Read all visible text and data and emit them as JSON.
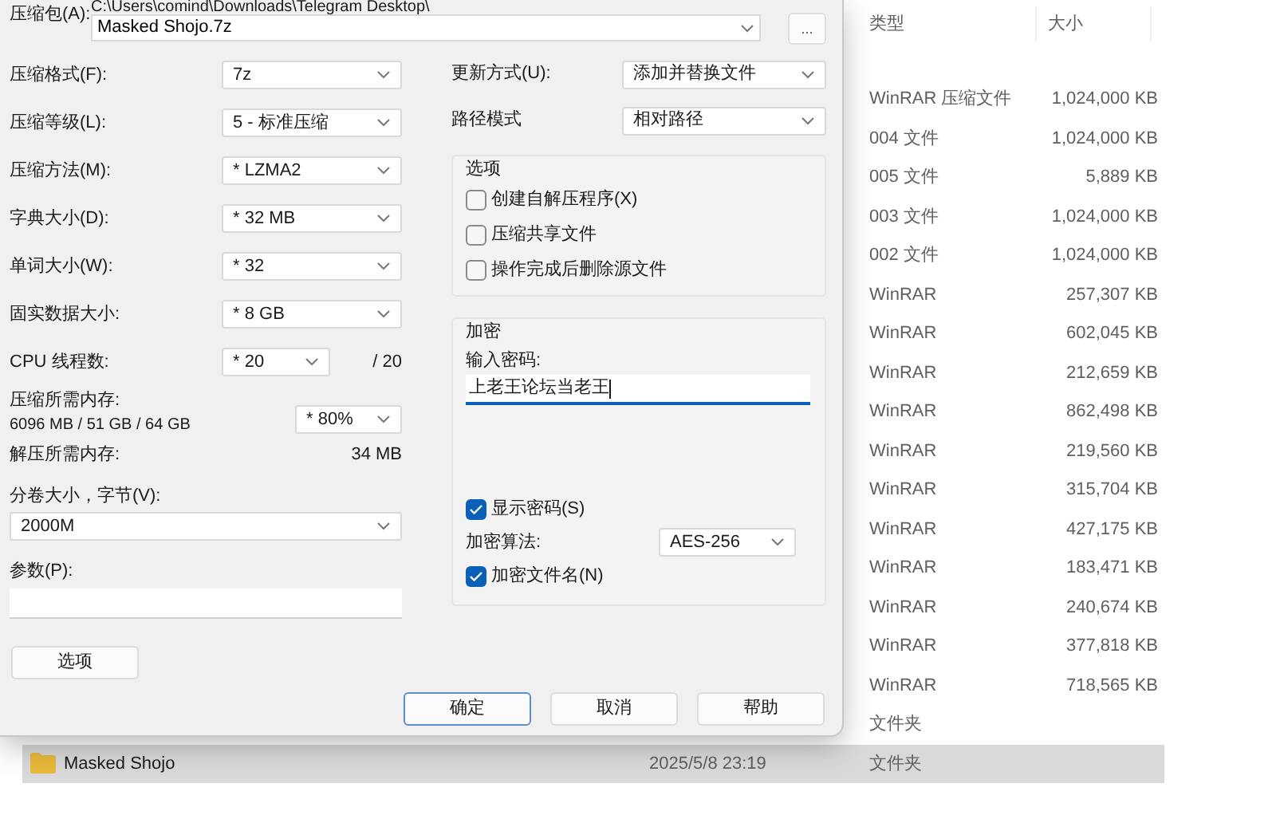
{
  "explorer": {
    "columns": [
      "类型",
      "大小"
    ],
    "rows": [
      {
        "type": "WinRAR 压缩文件",
        "size": "1,024,000 KB",
        "selected": false
      },
      {
        "type": "004 文件",
        "size": "1,024,000 KB",
        "selected": false
      },
      {
        "type": "005 文件",
        "size": "5,889 KB",
        "selected": false
      },
      {
        "type": "003 文件",
        "size": "1,024,000 KB",
        "selected": false
      },
      {
        "type": "002 文件",
        "size": "1,024,000 KB",
        "selected": false
      },
      {
        "type": "WinRAR",
        "size": "257,307 KB",
        "selected": false
      },
      {
        "type": "WinRAR",
        "size": "602,045 KB",
        "selected": false
      },
      {
        "type": "WinRAR",
        "size": "212,659 KB",
        "selected": false
      },
      {
        "type": "WinRAR",
        "size": "862,498 KB",
        "selected": false
      },
      {
        "type": "WinRAR",
        "size": "219,560 KB",
        "selected": false
      },
      {
        "type": "WinRAR",
        "size": "315,704 KB",
        "selected": false
      },
      {
        "type": "WinRAR",
        "size": "427,175 KB",
        "selected": false
      },
      {
        "type": "WinRAR",
        "size": "183,471 KB",
        "selected": false
      },
      {
        "type": "WinRAR",
        "size": "240,674 KB",
        "selected": false
      },
      {
        "type": "WinRAR",
        "size": "377,818 KB",
        "selected": false
      },
      {
        "type": "WinRAR",
        "size": "718,565 KB",
        "selected": false
      },
      {
        "type": "文件夹",
        "selected": false
      },
      {
        "kind": "folder",
        "name": "Masked Shojo",
        "date": "2025/5/8 23:19",
        "type": "文件夹",
        "selected": true
      }
    ]
  },
  "dialog": {
    "archive": {
      "label": "压缩包(A):",
      "path": "C:\\Users\\comind\\Downloads\\Telegram Desktop\\",
      "value": "Masked Shojo.7z",
      "browse": "..."
    },
    "settings": [
      {
        "label": "压缩格式(F):",
        "value": "7z"
      },
      {
        "label": "压缩等级(L):",
        "value": "5 - 标准压缩"
      },
      {
        "label": "压缩方法(M):",
        "value": "* LZMA2"
      },
      {
        "label": "字典大小(D):",
        "value": "* 32 MB"
      },
      {
        "label": "单词大小(W):",
        "value": "* 32"
      },
      {
        "label": "固实数据大小:",
        "value": "* 8 GB"
      },
      {
        "label": "CPU 线程数:",
        "value": "* 20",
        "total": "/ 20"
      }
    ],
    "memory": {
      "label": "压缩所需内存:",
      "detail": "6096 MB / 51 GB / 64 GB",
      "value": "* 80%"
    },
    "decompress": {
      "label": "解压所需内存:",
      "value": "34 MB"
    },
    "volume": {
      "label": "分卷大小，字节(V):",
      "value": "2000M"
    },
    "parameters": {
      "label": "参数(P):"
    },
    "options_button": "选项",
    "update": [
      {
        "label": "更新方式(U):",
        "value": "添加并替换文件"
      },
      {
        "label": "路径模式",
        "value": "相对路径"
      }
    ],
    "options_group": {
      "title": "选项",
      "items": [
        {
          "label": "创建自解压程序(X)",
          "checked": false
        },
        {
          "label": "压缩共享文件",
          "checked": false
        },
        {
          "label": "操作完成后删除源文件",
          "checked": false
        }
      ]
    },
    "encryption": {
      "title": "加密",
      "password_label": "输入密码:",
      "password": "上老王论坛当老王",
      "show_password": {
        "label": "显示密码(S)",
        "checked": true
      },
      "method_label": "加密算法:",
      "method": "AES-256",
      "encrypt_names": {
        "label": "加密文件名(N)",
        "checked": true
      }
    },
    "buttons": [
      {
        "label": "确定",
        "focused": true
      },
      {
        "label": "取消",
        "focused": false
      },
      {
        "label": "帮助",
        "focused": false
      }
    ]
  }
}
